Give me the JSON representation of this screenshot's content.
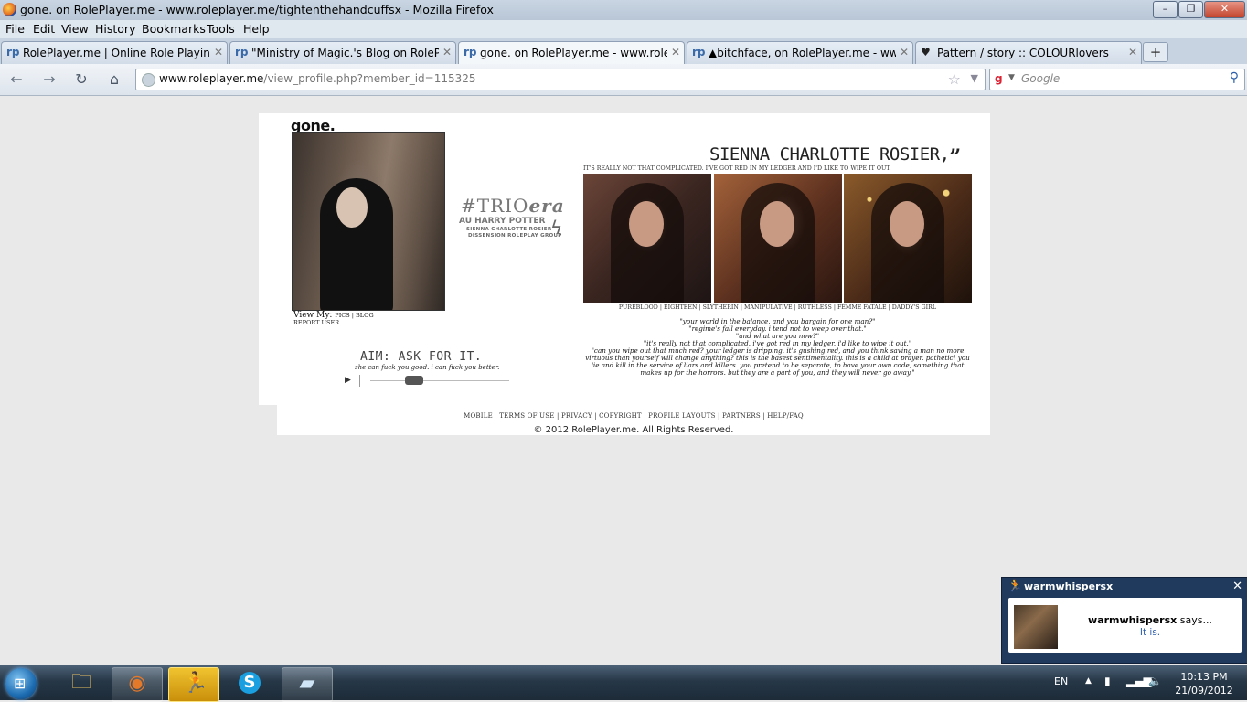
{
  "window": {
    "title": "gone. on RolePlayer.me - www.roleplayer.me/tightenthehandcuffsx - Mozilla Firefox",
    "minimize": "–",
    "maximize": "❐",
    "close": "✕"
  },
  "menu": [
    "File",
    "Edit",
    "View",
    "History",
    "Bookmarks",
    "Tools",
    "Help"
  ],
  "tabs": [
    {
      "icon": "rp",
      "label": "RolePlayer.me | Online Role Playing C...",
      "close": "✕"
    },
    {
      "icon": "rp",
      "label": "\"Ministry of Magic.'s Blog on RolePla...",
      "close": "✕"
    },
    {
      "icon": "rp",
      "label": "gone. on RolePlayer.me - www.rolepl...",
      "close": "✕"
    },
    {
      "icon": "rp",
      "label": "▲bitchface, on RolePlayer.me - www....",
      "close": "✕"
    },
    {
      "icon": "♥",
      "label": "Pattern / story :: COLOURlovers",
      "close": "✕"
    }
  ],
  "new_tab": "+",
  "nav": {
    "url_domain": "www.roleplayer.me",
    "url_path": "/view_profile.php?member_id=115325",
    "search_placeholder": "Google"
  },
  "profile": {
    "name": "gone.",
    "view_my_label": "View My:",
    "view_my_links": "PICS | BLOG",
    "report": "REPORT USER",
    "logo_line1": "#TRIO",
    "logo_line1b": "era",
    "logo_line2": "AU HARRY POTTER",
    "logo_line3": "SIENNA CHARLOTTE ROSIER",
    "logo_line4": "DISSENSION ROLEPLAY GROUP",
    "aim_title": "AIM: ASK FOR IT.",
    "aim_sub": "she can fuck you good. i can fuck you better.",
    "character_name": "SIENNA CHARLOTTE ROSIER,",
    "character_quote_mark": "”",
    "top_quote": "IT'S REALLY NOT THAT COMPLICATED. I'VE GOT RED IN MY LEDGER AND I'D LIKE TO WIPE IT OUT.",
    "tags": "PUREBLOOD | EIGHTEEN | SLYTHERIN | MANIPULATIVE | RUTHLESS | FEMME FATALE | DADDY'S GIRL",
    "poem": [
      "\"your world in the balance, and you bargain for one man?\"",
      "\"regime's fall everyday. i tend not to weep over that.\"",
      "\"and what are you now?\"",
      "\"it's really not that complicated. i've got red in my ledger. i'd like to wipe it out.\"",
      "\"can you wipe out that much red? your ledger is dripping. it's gushing red, and you think saving a man no more",
      "virtuous than yourself will change anything? this is the basest sentimentality. this is a child at prayer. pathetic! you",
      "lie and kill in the service of liars and killers. you pretend to be separate, to have your own code, something that",
      "makes up for the horrors. but they are a part of you, and they will never go away.\""
    ]
  },
  "footer": {
    "links": "MOBILE | TERMS OF USE | PRIVACY | COPYRIGHT | PROFILE LAYOUTS | PARTNERS | HELP/FAQ",
    "copyright": "© 2012 RolePlayer.me. All Rights Reserved."
  },
  "notification": {
    "header_name": "warmwhispersx",
    "sender": "warmwhispersx",
    "says": " says...",
    "message": "It is.",
    "close": "✕"
  },
  "taskbar": {
    "lang": "EN",
    "time": "10:13 PM",
    "date": "21/09/2012"
  }
}
